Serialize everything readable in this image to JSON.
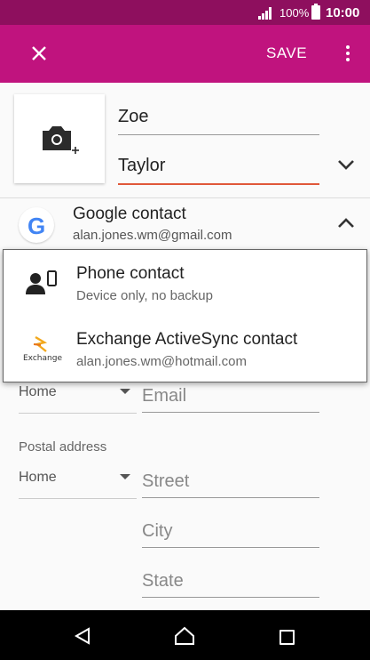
{
  "status": {
    "battery_pct": "100%",
    "time": "10:00"
  },
  "app_bar": {
    "save_label": "SAVE"
  },
  "name": {
    "first": "Zoe",
    "last": "Taylor"
  },
  "account": {
    "name": "Google contact",
    "email": "alan.jones.wm@gmail.com"
  },
  "dropdown": {
    "items": [
      {
        "title": "Phone contact",
        "subtitle": "Device only, no backup"
      },
      {
        "title": "Exchange ActiveSync contact",
        "subtitle": "alan.jones.wm@hotmail.com"
      }
    ]
  },
  "email": {
    "type": "Home",
    "placeholder": "Email"
  },
  "postal": {
    "label": "Postal address",
    "type": "Home",
    "street": "Street",
    "city": "City",
    "state": "State"
  },
  "colors": {
    "status_bar": "#8e0f5e",
    "app_bar": "#c0137e",
    "accent_underline": "#e0583a"
  },
  "icons": {
    "close": "close-icon",
    "more": "more-vert-icon",
    "camera": "camera-add-icon",
    "google": "google-logo-icon",
    "phone": "phone-contact-icon",
    "exchange": "exchange-logo-icon"
  }
}
